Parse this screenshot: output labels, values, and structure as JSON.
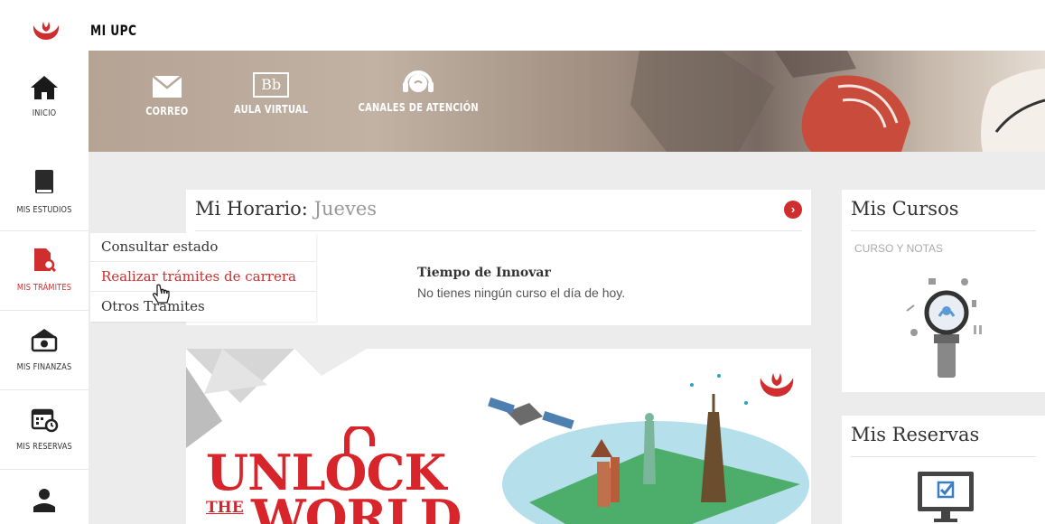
{
  "app": {
    "title": "MI UPC",
    "brand_color": "#d02e2e"
  },
  "sidebar": {
    "items": [
      {
        "label": "INICIO",
        "icon": "home-icon"
      },
      {
        "label": "MIS ESTUDIOS",
        "icon": "book-icon"
      },
      {
        "label": "MIS TRÁMITES",
        "icon": "document-search-icon",
        "active": true
      },
      {
        "label": "MIS FINANZAS",
        "icon": "money-icon"
      },
      {
        "label": "MIS RESERVAS",
        "icon": "calendar-icon"
      },
      {
        "label": "",
        "icon": "user-icon"
      }
    ]
  },
  "hero": {
    "tiles": [
      {
        "label": "CORREO",
        "icon": "mail-icon"
      },
      {
        "label": "AULA VIRTUAL",
        "icon": "blackboard-icon",
        "icon_text": "Bb"
      },
      {
        "label": "CANALES DE ATENCIÓN",
        "icon": "headset-icon"
      }
    ]
  },
  "schedule": {
    "title": "Mi Horario:",
    "day": "Jueves",
    "course": "Tiempo de Innovar",
    "message": "No tienes ningún curso el día de hoy."
  },
  "dropdown": {
    "items": [
      "Consultar estado",
      "Realizar trámites de carrera",
      "Otros Trámites"
    ],
    "hovered_index": 1
  },
  "courses_card": {
    "title": "Mis Cursos",
    "subtitle": "CURSO Y NOTAS"
  },
  "reservations_card": {
    "title": "Mis Reservas"
  },
  "banner": {
    "line1": "UNLOCK",
    "line2_small": "THE",
    "line2": "WORLD"
  }
}
